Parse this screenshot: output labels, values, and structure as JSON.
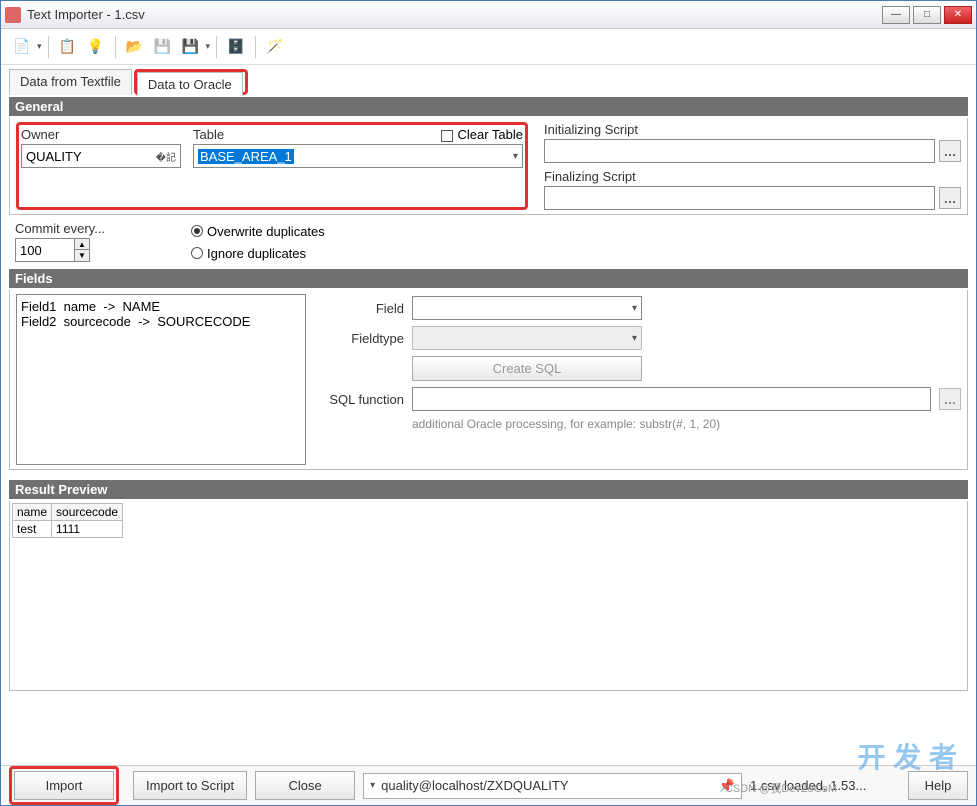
{
  "window": {
    "title": "Text Importer - 1.csv"
  },
  "tabs": {
    "textfile": "Data from Textfile",
    "oracle": "Data to Oracle"
  },
  "general": {
    "header": "General",
    "owner_label": "Owner",
    "owner_value": "QUALITY",
    "table_label": "Table",
    "table_value": "BASE_AREA_1",
    "clear_table": "Clear Table",
    "commit_label": "Commit every...",
    "commit_value": "100",
    "overwrite": "Overwrite duplicates",
    "ignore": "Ignore duplicates",
    "init_label": "Initializing Script",
    "final_label": "Finalizing Script"
  },
  "fields": {
    "header": "Fields",
    "list_line1": "Field1  name  ->  NAME",
    "list_line2": "Field2  sourcecode  ->  SOURCECODE",
    "field_label": "Field",
    "fieldtype_label": "Fieldtype",
    "create_sql": "Create SQL",
    "sqlfn_label": "SQL function",
    "hint": "additional Oracle processing, for example: substr(#, 1, 20)"
  },
  "preview": {
    "header": "Result Preview",
    "col1": "name",
    "col2": "sourcecode",
    "r1c1": "test",
    "r1c2": "1111"
  },
  "bottom": {
    "import": "Import",
    "import_script": "Import to Script",
    "close": "Close",
    "connection": "quality@localhost/ZXDQUALITY",
    "status": "1.csv loaded, 1.53...",
    "help": "Help"
  },
  "watermark": "开 发 者",
  "watermark2": "CSDN @我DevZeCoM"
}
